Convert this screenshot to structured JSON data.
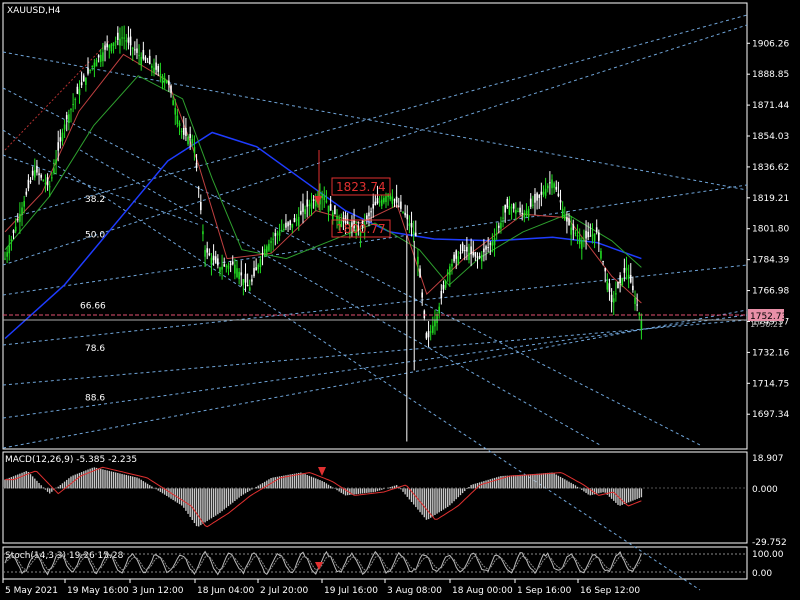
{
  "chart_data": [
    {
      "type": "candlestick",
      "title": "XAUUSD,H4",
      "ylim": [
        1680,
        1925
      ],
      "y_ticks": [
        "1906.26",
        "1888.85",
        "1871.44",
        "1854.03",
        "1836.62",
        "1819.21",
        "1801.80",
        "1784.39",
        "1766.98",
        "1749.57",
        "1732.16",
        "1714.75",
        "1697.34"
      ],
      "x_ticks": [
        "5 May 2021",
        "19 May 16:00",
        "3 Jun 12:00",
        "18 Jun 04:00",
        "2 Jul 20:00",
        "19 Jul 16:00",
        "3 Aug 08:00",
        "18 Aug 00:00",
        "1 Sep 16:00",
        "16 Sep 12:00"
      ],
      "current_price": "1752.73",
      "bid_line": "1750.21",
      "annotations": [
        "1823.74",
        "1800.77"
      ],
      "fib_levels": [
        {
          "label": "38.2",
          "value": 1817
        },
        {
          "label": "50.0",
          "value": 1797
        },
        {
          "label": "66.66",
          "value": 1757
        },
        {
          "label": "78.6",
          "value": 1733
        },
        {
          "label": "88.6",
          "value": 1705
        }
      ],
      "close_path": [
        {
          "t": 0,
          "v": 1785
        },
        {
          "t": 0.02,
          "v": 1810
        },
        {
          "t": 0.04,
          "v": 1835
        },
        {
          "t": 0.06,
          "v": 1825
        },
        {
          "t": 0.08,
          "v": 1860
        },
        {
          "t": 0.1,
          "v": 1880
        },
        {
          "t": 0.12,
          "v": 1895
        },
        {
          "t": 0.14,
          "v": 1905
        },
        {
          "t": 0.16,
          "v": 1910
        },
        {
          "t": 0.18,
          "v": 1900
        },
        {
          "t": 0.2,
          "v": 1893
        },
        {
          "t": 0.22,
          "v": 1885
        },
        {
          "t": 0.24,
          "v": 1855
        },
        {
          "t": 0.255,
          "v": 1852
        },
        {
          "t": 0.27,
          "v": 1790
        },
        {
          "t": 0.29,
          "v": 1780
        },
        {
          "t": 0.31,
          "v": 1782
        },
        {
          "t": 0.33,
          "v": 1768
        },
        {
          "t": 0.35,
          "v": 1790
        },
        {
          "t": 0.37,
          "v": 1800
        },
        {
          "t": 0.39,
          "v": 1805
        },
        {
          "t": 0.41,
          "v": 1815
        },
        {
          "t": 0.43,
          "v": 1822
        },
        {
          "t": 0.44,
          "v": 1812
        },
        {
          "t": 0.46,
          "v": 1805
        },
        {
          "t": 0.48,
          "v": 1800
        },
        {
          "t": 0.5,
          "v": 1815
        },
        {
          "t": 0.52,
          "v": 1822
        },
        {
          "t": 0.54,
          "v": 1810
        },
        {
          "t": 0.555,
          "v": 1798
        },
        {
          "t": 0.57,
          "v": 1738
        },
        {
          "t": 0.585,
          "v": 1755
        },
        {
          "t": 0.6,
          "v": 1780
        },
        {
          "t": 0.62,
          "v": 1790
        },
        {
          "t": 0.64,
          "v": 1785
        },
        {
          "t": 0.66,
          "v": 1795
        },
        {
          "t": 0.68,
          "v": 1815
        },
        {
          "t": 0.7,
          "v": 1810
        },
        {
          "t": 0.72,
          "v": 1818
        },
        {
          "t": 0.74,
          "v": 1830
        },
        {
          "t": 0.76,
          "v": 1805
        },
        {
          "t": 0.78,
          "v": 1795
        },
        {
          "t": 0.8,
          "v": 1800
        },
        {
          "t": 0.82,
          "v": 1760
        },
        {
          "t": 0.84,
          "v": 1780
        },
        {
          "t": 0.86,
          "v": 1750
        }
      ],
      "ma_blue": [
        {
          "t": 0.0,
          "v": 1740
        },
        {
          "t": 0.08,
          "v": 1770
        },
        {
          "t": 0.16,
          "v": 1810
        },
        {
          "t": 0.22,
          "v": 1840
        },
        {
          "t": 0.28,
          "v": 1856
        },
        {
          "t": 0.34,
          "v": 1848
        },
        {
          "t": 0.4,
          "v": 1830
        },
        {
          "t": 0.46,
          "v": 1812
        },
        {
          "t": 0.52,
          "v": 1800
        },
        {
          "t": 0.58,
          "v": 1796
        },
        {
          "t": 0.66,
          "v": 1795
        },
        {
          "t": 0.74,
          "v": 1797
        },
        {
          "t": 0.8,
          "v": 1794
        },
        {
          "t": 0.86,
          "v": 1785
        }
      ],
      "ma_green": [
        {
          "t": 0.0,
          "v": 1790
        },
        {
          "t": 0.06,
          "v": 1820
        },
        {
          "t": 0.12,
          "v": 1860
        },
        {
          "t": 0.18,
          "v": 1888
        },
        {
          "t": 0.24,
          "v": 1875
        },
        {
          "t": 0.28,
          "v": 1830
        },
        {
          "t": 0.32,
          "v": 1790
        },
        {
          "t": 0.38,
          "v": 1785
        },
        {
          "t": 0.44,
          "v": 1795
        },
        {
          "t": 0.5,
          "v": 1805
        },
        {
          "t": 0.56,
          "v": 1790
        },
        {
          "t": 0.6,
          "v": 1770
        },
        {
          "t": 0.64,
          "v": 1785
        },
        {
          "t": 0.7,
          "v": 1800
        },
        {
          "t": 0.76,
          "v": 1810
        },
        {
          "t": 0.82,
          "v": 1795
        },
        {
          "t": 0.86,
          "v": 1780
        }
      ],
      "ma_red": [
        {
          "t": 0.0,
          "v": 1800
        },
        {
          "t": 0.05,
          "v": 1822
        },
        {
          "t": 0.1,
          "v": 1868
        },
        {
          "t": 0.16,
          "v": 1900
        },
        {
          "t": 0.22,
          "v": 1885
        },
        {
          "t": 0.26,
          "v": 1840
        },
        {
          "t": 0.3,
          "v": 1785
        },
        {
          "t": 0.36,
          "v": 1788
        },
        {
          "t": 0.42,
          "v": 1812
        },
        {
          "t": 0.48,
          "v": 1805
        },
        {
          "t": 0.53,
          "v": 1815
        },
        {
          "t": 0.57,
          "v": 1765
        },
        {
          "t": 0.62,
          "v": 1785
        },
        {
          "t": 0.7,
          "v": 1810
        },
        {
          "t": 0.76,
          "v": 1808
        },
        {
          "t": 0.82,
          "v": 1775
        },
        {
          "t": 0.86,
          "v": 1760
        }
      ]
    },
    {
      "type": "histogram",
      "title": "MACD(12,26,9) -5.385 -2.235",
      "ylim": [
        -29.752,
        18.907
      ],
      "y_ticks": [
        "18.907",
        "0.000",
        "-29.752"
      ],
      "values": [
        {
          "t": 0.0,
          "v": 5
        },
        {
          "t": 0.03,
          "v": 10
        },
        {
          "t": 0.06,
          "v": -3
        },
        {
          "t": 0.09,
          "v": 7
        },
        {
          "t": 0.12,
          "v": 12
        },
        {
          "t": 0.15,
          "v": 9
        },
        {
          "t": 0.18,
          "v": 6
        },
        {
          "t": 0.21,
          "v": -2
        },
        {
          "t": 0.24,
          "v": -10
        },
        {
          "t": 0.26,
          "v": -22
        },
        {
          "t": 0.29,
          "v": -14
        },
        {
          "t": 0.32,
          "v": -4
        },
        {
          "t": 0.36,
          "v": 6
        },
        {
          "t": 0.4,
          "v": 9
        },
        {
          "t": 0.43,
          "v": 4
        },
        {
          "t": 0.46,
          "v": -4
        },
        {
          "t": 0.5,
          "v": -2
        },
        {
          "t": 0.53,
          "v": 2
        },
        {
          "t": 0.55,
          "v": -8
        },
        {
          "t": 0.57,
          "v": -18
        },
        {
          "t": 0.6,
          "v": -10
        },
        {
          "t": 0.63,
          "v": 2
        },
        {
          "t": 0.67,
          "v": 7
        },
        {
          "t": 0.71,
          "v": 8
        },
        {
          "t": 0.74,
          "v": 9
        },
        {
          "t": 0.77,
          "v": 2
        },
        {
          "t": 0.79,
          "v": -4
        },
        {
          "t": 0.81,
          "v": -2
        },
        {
          "t": 0.83,
          "v": -10
        },
        {
          "t": 0.86,
          "v": -5
        }
      ]
    },
    {
      "type": "line",
      "title": "Stoch(14,3,3) 19.26 15.28",
      "ylim": [
        0,
        100
      ],
      "y_ticks": [
        "100.00",
        "0.00"
      ]
    }
  ]
}
